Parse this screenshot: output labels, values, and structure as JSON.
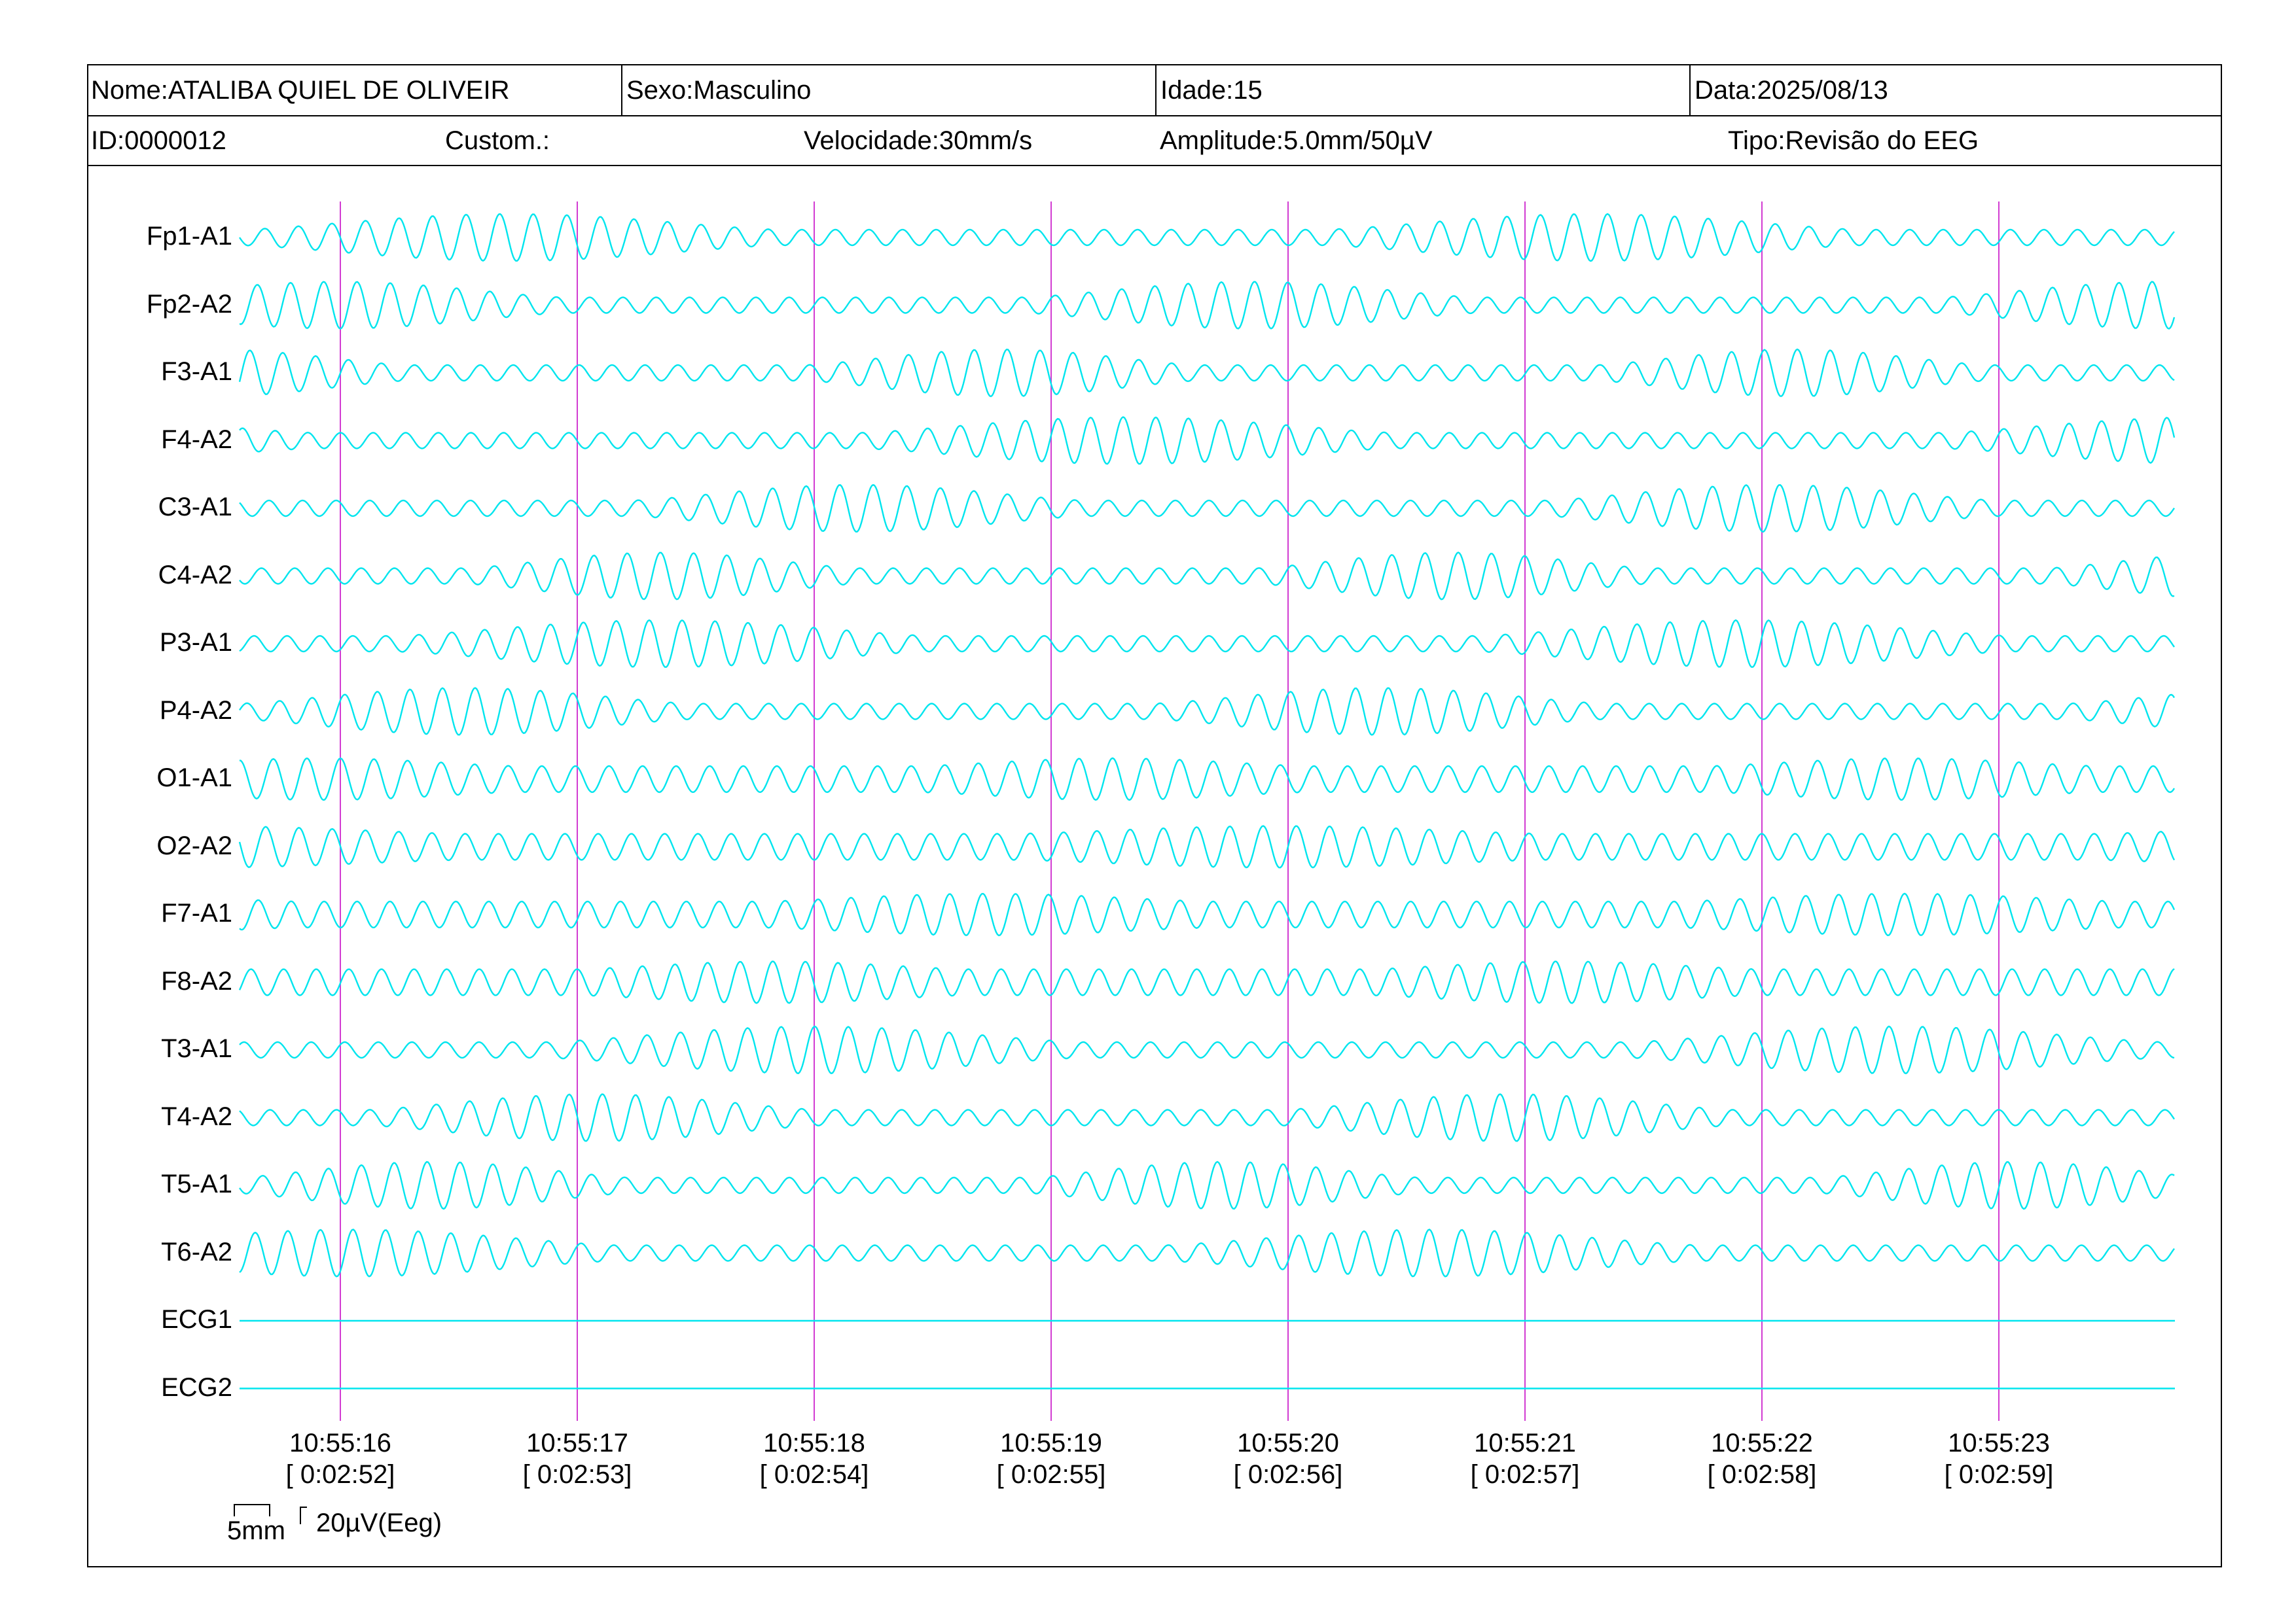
{
  "header": {
    "name": "Nome:ATALIBA QUIEL DE OLIVEIR",
    "sex": "Sexo:Masculino",
    "age": "Idade:15",
    "date": "Data:2025/08/13",
    "id": "ID:0000012",
    "custom": "Custom.:",
    "speed": "Velocidade:30mm/s",
    "amplitude": "Amplitude:5.0mm/50µV",
    "type": "Tipo:Revisão do EEG"
  },
  "channels": [
    "Fp1-A1",
    "Fp2-A2",
    "F3-A1",
    "F4-A2",
    "C3-A1",
    "C4-A2",
    "P3-A1",
    "P4-A2",
    "O1-A1",
    "O2-A2",
    "F7-A1",
    "F8-A2",
    "T3-A1",
    "T4-A2",
    "T5-A1",
    "T6-A2",
    "ECG1",
    "ECG2"
  ],
  "flat_channels": [
    "ECG1",
    "ECG2"
  ],
  "time_marks": [
    {
      "clock": "10:55:16",
      "elapsed": "[ 0:02:52]"
    },
    {
      "clock": "10:55:17",
      "elapsed": "[ 0:02:53]"
    },
    {
      "clock": "10:55:18",
      "elapsed": "[ 0:02:54]"
    },
    {
      "clock": "10:55:19",
      "elapsed": "[ 0:02:55]"
    },
    {
      "clock": "10:55:20",
      "elapsed": "[ 0:02:56]"
    },
    {
      "clock": "10:55:21",
      "elapsed": "[ 0:02:57]"
    },
    {
      "clock": "10:55:22",
      "elapsed": "[ 0:02:58]"
    },
    {
      "clock": "10:55:23",
      "elapsed": "[ 0:02:59]"
    }
  ],
  "scale": {
    "time_label": "5mm",
    "amp_label": "20µV(Eeg)"
  },
  "colors": {
    "trace": "#00e5ee",
    "marker": "#d23cd2",
    "text": "#000000"
  }
}
